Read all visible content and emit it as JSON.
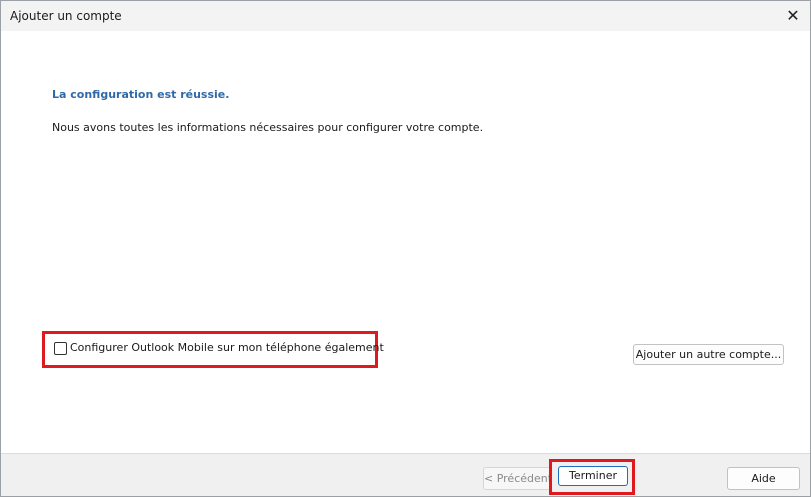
{
  "window": {
    "title": "Ajouter un compte",
    "close_glyph": "✕"
  },
  "content": {
    "heading": "La configuration est réussie.",
    "info": "Nous avons toutes les informations nécessaires pour configurer votre compte.",
    "mobile_checkbox_label": "Configurer Outlook Mobile sur mon téléphone également",
    "mobile_checkbox_checked": false,
    "add_account_button": "Ajouter un autre compte..."
  },
  "footer": {
    "previous_button": "< Précédent",
    "finish_button": "Terminer",
    "help_button": "Aide"
  },
  "colors": {
    "heading": "#2f6aa8",
    "highlight": "#e0191e",
    "default_button_border": "#1f6fbf"
  }
}
